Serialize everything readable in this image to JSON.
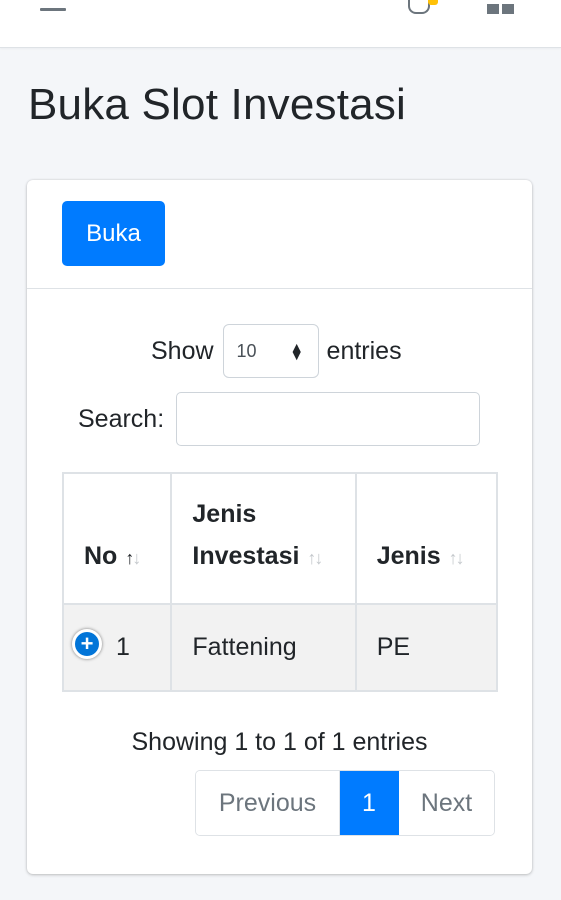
{
  "navbar": {
    "menu_icon": "hamburger-icon",
    "notification_icon": "bell-icon",
    "notification_badge_color": "#ffc107",
    "apps_icon": "grid-icon"
  },
  "page": {
    "title": "Buka Slot Investasi"
  },
  "card": {
    "open_button_label": "Buka"
  },
  "datatable": {
    "length": {
      "show_label": "Show",
      "selected": "10",
      "entries_label": "entries"
    },
    "search": {
      "label": "Search:",
      "value": "",
      "placeholder": ""
    },
    "columns": [
      {
        "label": "No",
        "sort": "asc"
      },
      {
        "label": "Jenis Investasi",
        "sort": "none"
      },
      {
        "label": "Jenis",
        "sort": "none"
      }
    ],
    "rows": [
      {
        "no": "1",
        "jenis_investasi": "Fattening",
        "jenis": "PE"
      }
    ],
    "info": "Showing 1 to 1 of 1 entries",
    "pagination": {
      "previous": "Previous",
      "current_page": "1",
      "next": "Next"
    }
  },
  "colors": {
    "primary": "#007bff",
    "background": "#f4f6f9"
  }
}
